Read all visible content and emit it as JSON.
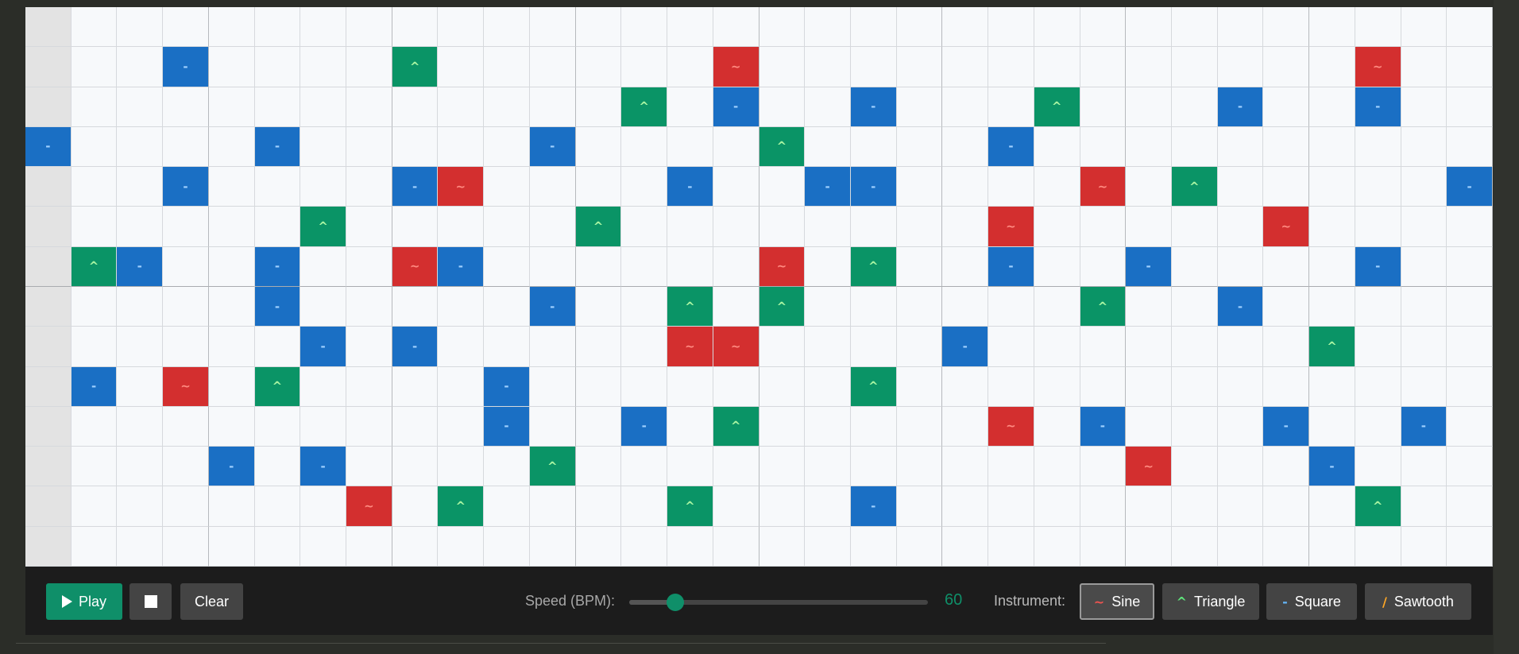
{
  "colors": {
    "sine": "#d32f2f",
    "triangle": "#0a9466",
    "square": "#1a6fc4",
    "sawtooth": "#e07b1a",
    "accent": "#0f8f69"
  },
  "instrument_symbols": {
    "sine": "~",
    "triangle": "^",
    "square": "-",
    "sawtooth": "/"
  },
  "grid": {
    "columns": 32,
    "rows": 14,
    "notes": [
      [
        1,
        3,
        "square"
      ],
      [
        1,
        8,
        "triangle"
      ],
      [
        1,
        15,
        "sine"
      ],
      [
        1,
        29,
        "sine"
      ],
      [
        2,
        13,
        "triangle"
      ],
      [
        2,
        15,
        "square"
      ],
      [
        2,
        18,
        "square"
      ],
      [
        2,
        22,
        "triangle"
      ],
      [
        2,
        26,
        "square"
      ],
      [
        2,
        29,
        "square"
      ],
      [
        3,
        0,
        "square"
      ],
      [
        3,
        5,
        "square"
      ],
      [
        3,
        11,
        "square"
      ],
      [
        3,
        16,
        "triangle"
      ],
      [
        3,
        21,
        "square"
      ],
      [
        4,
        3,
        "square"
      ],
      [
        4,
        8,
        "square"
      ],
      [
        4,
        9,
        "sine"
      ],
      [
        4,
        14,
        "square"
      ],
      [
        4,
        17,
        "square"
      ],
      [
        4,
        18,
        "square"
      ],
      [
        4,
        23,
        "sine"
      ],
      [
        4,
        25,
        "triangle"
      ],
      [
        4,
        31,
        "square"
      ],
      [
        5,
        6,
        "triangle"
      ],
      [
        5,
        12,
        "triangle"
      ],
      [
        5,
        21,
        "sine"
      ],
      [
        5,
        27,
        "sine"
      ],
      [
        6,
        1,
        "triangle"
      ],
      [
        6,
        2,
        "square"
      ],
      [
        6,
        5,
        "square"
      ],
      [
        6,
        8,
        "sine"
      ],
      [
        6,
        9,
        "square"
      ],
      [
        6,
        16,
        "sine"
      ],
      [
        6,
        18,
        "triangle"
      ],
      [
        6,
        21,
        "square"
      ],
      [
        6,
        24,
        "square"
      ],
      [
        6,
        29,
        "square"
      ],
      [
        7,
        5,
        "square"
      ],
      [
        7,
        11,
        "square"
      ],
      [
        7,
        14,
        "triangle"
      ],
      [
        7,
        16,
        "triangle"
      ],
      [
        7,
        23,
        "triangle"
      ],
      [
        7,
        26,
        "square"
      ],
      [
        8,
        6,
        "square"
      ],
      [
        8,
        8,
        "square"
      ],
      [
        8,
        14,
        "sine"
      ],
      [
        8,
        15,
        "sine"
      ],
      [
        8,
        20,
        "square"
      ],
      [
        8,
        28,
        "triangle"
      ],
      [
        9,
        1,
        "square"
      ],
      [
        9,
        3,
        "sine"
      ],
      [
        9,
        5,
        "triangle"
      ],
      [
        9,
        10,
        "square"
      ],
      [
        9,
        18,
        "triangle"
      ],
      [
        10,
        10,
        "square"
      ],
      [
        10,
        13,
        "square"
      ],
      [
        10,
        15,
        "triangle"
      ],
      [
        10,
        21,
        "sine"
      ],
      [
        10,
        23,
        "square"
      ],
      [
        10,
        27,
        "square"
      ],
      [
        10,
        30,
        "square"
      ],
      [
        11,
        4,
        "square"
      ],
      [
        11,
        6,
        "square"
      ],
      [
        11,
        11,
        "triangle"
      ],
      [
        11,
        24,
        "sine"
      ],
      [
        11,
        28,
        "square"
      ],
      [
        12,
        7,
        "sine"
      ],
      [
        12,
        9,
        "triangle"
      ],
      [
        12,
        14,
        "triangle"
      ],
      [
        12,
        18,
        "square"
      ],
      [
        12,
        29,
        "triangle"
      ]
    ]
  },
  "toolbar": {
    "play_label": "Play",
    "clear_label": "Clear",
    "speed_label": "Speed (BPM):",
    "bpm_value": "60",
    "bpm_min": 40,
    "bpm_max": 240,
    "instrument_label": "Instrument:",
    "selected_instrument": "sine",
    "instruments": {
      "sine": {
        "label": "Sine",
        "symbol": "~",
        "symbol_color": "#ef5350"
      },
      "triangle": {
        "label": "Triangle",
        "symbol": "^",
        "symbol_color": "#5ee37a"
      },
      "square": {
        "label": "Square",
        "symbol": "-",
        "symbol_color": "#64b5f6"
      },
      "sawtooth": {
        "label": "Sawtooth",
        "symbol": "/",
        "symbol_color": "#ffa726"
      }
    }
  }
}
